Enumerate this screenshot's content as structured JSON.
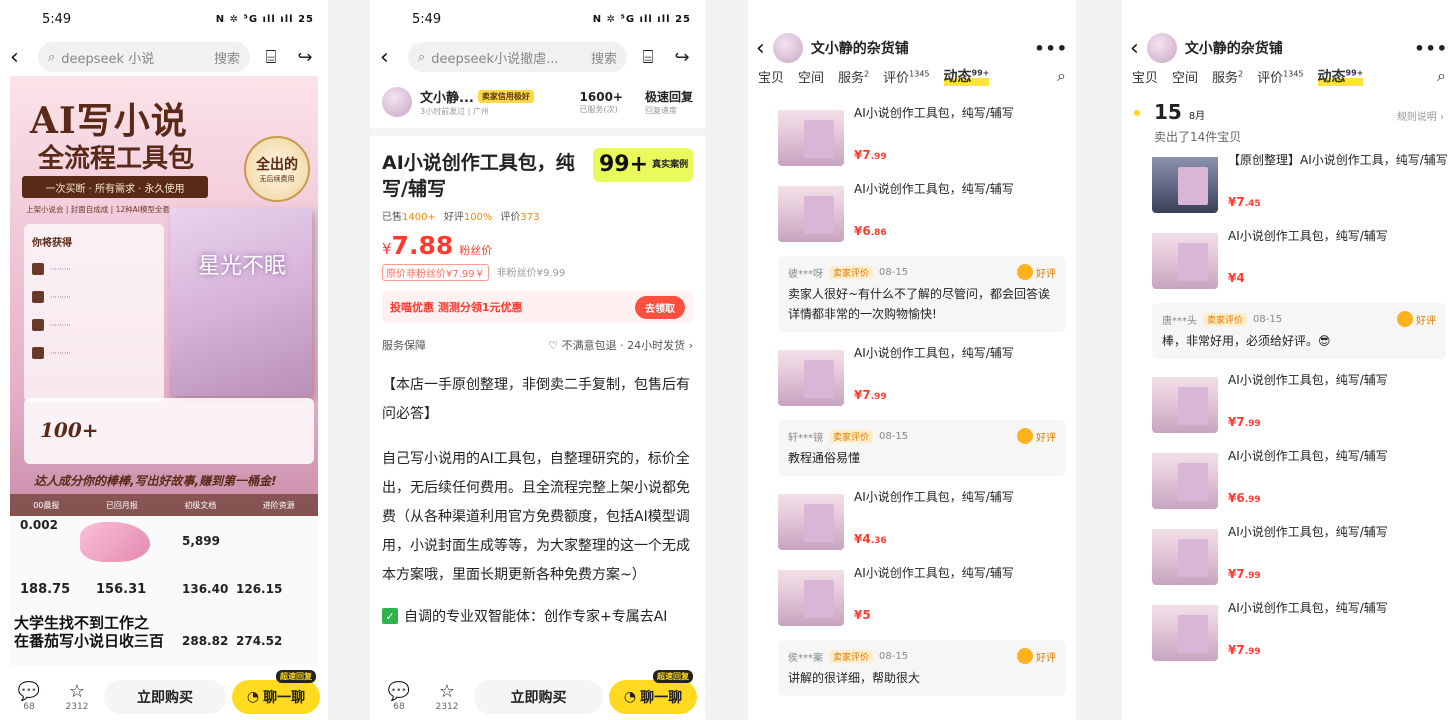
{
  "s1": {
    "time": "5:49",
    "status_icons": "N ✲ ⁵G ıll ıll 25",
    "search_query": "deepseek 小说",
    "search_go": "搜索",
    "poster": {
      "title": "AI写小说",
      "subtitle": "全流程工具包",
      "ribbon": "一次买断 · 所有需求 · 永久使用",
      "tagline": "上架小说会 | 封面自成成 | 12种AI模型全套",
      "seal_main": "全出的",
      "seal_sub": "无后续费用",
      "book_title": "星光不眠",
      "panel_head": "你将获得",
      "stat_big": "100+",
      "slogan": "达人成分你的棒棒,写出好故事,赚到第一桶金!",
      "footer": [
        "00晨报",
        "已回月报",
        "初级文档",
        "进阶资源"
      ]
    },
    "dash": {
      "n1": "0.002",
      "n2": "5,899",
      "n3": "188.75",
      "n4": "156.31",
      "n5": "136.40",
      "n6": "126.15",
      "n7": "288.82",
      "n8": "274.52",
      "caption1": "大学生找不到工作之",
      "caption2": "在番茄写小说日收三百"
    },
    "bottom": {
      "comments": "68",
      "favs": "2312",
      "buy": "立即购买",
      "chat": "聊一聊",
      "chat_mini": "超速回复"
    }
  },
  "s2": {
    "time": "5:49",
    "status_icons": "N ✲ ⁵G ıll ıll 25",
    "search_query": "deepseek小说撤虐...",
    "search_go": "搜索",
    "seller": {
      "name": "文小静...",
      "badge": "卖家信用极好",
      "meta": "3小时前发过 | 广州",
      "served": "1600+",
      "served_label": "已服务(次)",
      "speed": "极速回复",
      "speed_label": "回复速度"
    },
    "title": "AI小说创作工具包，纯写/辅写",
    "real_num": "99+",
    "real_label": "真实案例",
    "sold": "已售",
    "sold_v": "1400+",
    "good": "好评",
    "good_v": "100%",
    "rev": "评价",
    "rev_v": "373",
    "price_symbol": "¥",
    "price": "7.88",
    "price_tag": "粉丝价",
    "old_box": "原价非粉丝价¥7.99￥",
    "old_fan": "非粉丝价¥9.99",
    "coupon": "投喵优惠 测测分领1元优惠",
    "coupon_btn": "去领取",
    "svc_left": "服务保障",
    "svc_right": "♡ 不满意包退 · 24小时发货 ›",
    "desc1": "【本店一手原创整理，非倒卖二手复制，包售后有问必答】",
    "desc2": "自己写小说用的AI工具包，自整理研究的，标价全出，无后续任何费用。且全流程完整上架小说都免费（从各种渠道利用官方免费额度，包括AI模型调用，小说封面生成等等，为大家整理的这一个无成本方案哦，里面长期更新各种免费方案~）",
    "check": "自调的专业双智能体：创作专家+专属去AI",
    "bottom": {
      "comments": "68",
      "favs": "2312",
      "buy": "立即购买",
      "chat": "聊一聊",
      "chat_mini": "超速回复"
    }
  },
  "shop": {
    "name": "文小静的杂货铺",
    "tabs": [
      "宝贝",
      "空间",
      "服务",
      "评价",
      "动态"
    ],
    "tab_sup": [
      "",
      "",
      "2",
      "1345",
      "99+"
    ]
  },
  "s3": {
    "items": [
      {
        "t": "AI小说创作工具包，纯写/辅写",
        "p": "7",
        "c": ".99"
      },
      {
        "t": "AI小说创作工具包，纯写/辅写",
        "p": "6",
        "c": ".86"
      },
      {
        "t": "AI小说创作工具包，纯写/辅写",
        "p": "7",
        "c": ".99"
      },
      {
        "t": "AI小说创作工具包，纯写/辅写",
        "p": "4",
        "c": ".36"
      },
      {
        "t": "AI小说创作工具包，纯写/辅写",
        "p": "5",
        "c": ""
      }
    ],
    "reviews": [
      {
        "user": "彼***呀",
        "badge": "卖家评价",
        "date": "08-15",
        "good": "好评",
        "text": "卖家人很好~有什么不了解的尽管问，都会回答诶 详情都非常的一次购物愉快!"
      },
      {
        "user": "轩***镜",
        "badge": "卖家评价",
        "date": "08-15",
        "good": "好评",
        "text": "教程通俗易懂"
      },
      {
        "user": "侯***案",
        "badge": "卖家评价",
        "date": "08-15",
        "good": "好评",
        "text": "讲解的很详细，帮助很大"
      }
    ]
  },
  "s4": {
    "day": "15",
    "month": "8月",
    "rule": "规则说明 ›",
    "sold_sum": "卖出了14件宝贝",
    "items": [
      {
        "t": "【原创整理】AI小说创作工具，纯写/辅写",
        "p": "7",
        "c": ".45"
      },
      {
        "t": "AI小说创作工具包，纯写/辅写",
        "p": "4",
        "c": ""
      },
      {
        "t": "AI小说创作工具包，纯写/辅写",
        "p": "7",
        "c": ".99"
      },
      {
        "t": "AI小说创作工具包，纯写/辅写",
        "p": "6",
        "c": ".99"
      },
      {
        "t": "AI小说创作工具包，纯写/辅写",
        "p": "7",
        "c": ".99"
      },
      {
        "t": "AI小说创作工具包，纯写/辅写",
        "p": "7",
        "c": ".99"
      }
    ],
    "review": {
      "user": "唐***头",
      "badge": "卖家评价",
      "date": "08-15",
      "good": "好评",
      "text": "棒，非常好用，必须给好评。😎"
    }
  }
}
